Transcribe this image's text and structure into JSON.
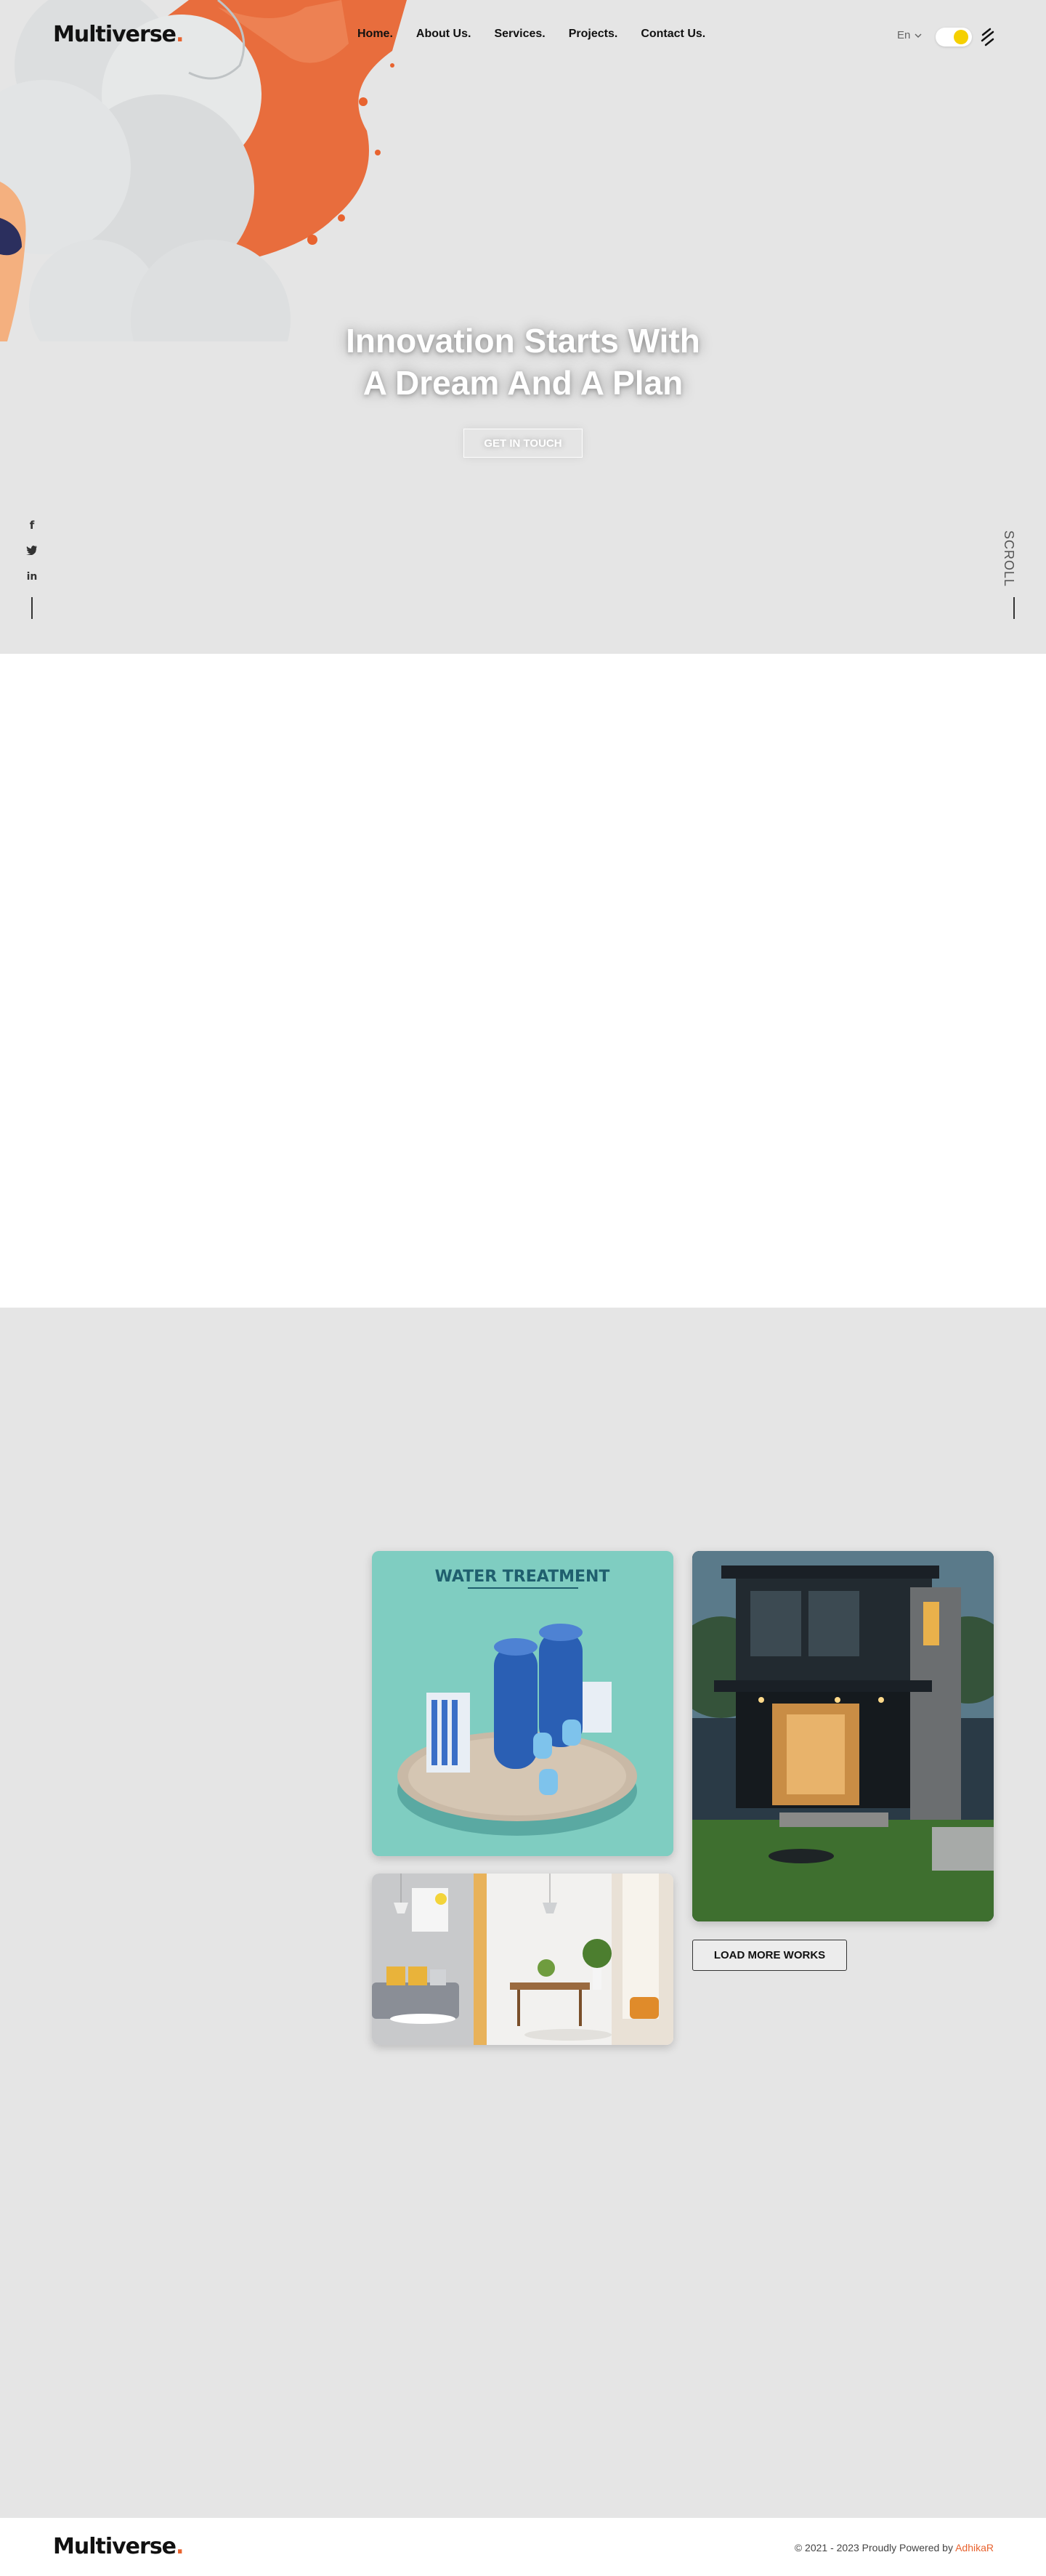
{
  "header": {
    "logo_text": "Multiverse",
    "logo_dot": ".",
    "nav": [
      "Home.",
      "About Us.",
      "Services.",
      "Projects.",
      "Contact Us."
    ],
    "language": "En",
    "theme_toggle": "light",
    "accent_color": "#e8632f",
    "toggle_color": "#f5d000"
  },
  "hero": {
    "title_line1": "Innovation Starts With",
    "title_line2": "A Dream And A Plan",
    "cta_label": "GET IN TOUCH",
    "social_icons": [
      "facebook-icon",
      "twitter-icon",
      "linkedin-icon"
    ],
    "scroll_label": "SCROLL"
  },
  "projects": {
    "water_card_title": "WATER TREATMENT",
    "load_more_label": "LOAD MORE WORKS"
  },
  "footer": {
    "logo_text": "Multiverse",
    "logo_dot": ".",
    "copyright_prefix": "© 2021 - 2023 Proudly Powered by",
    "copyright_link": "AdhikaR"
  }
}
